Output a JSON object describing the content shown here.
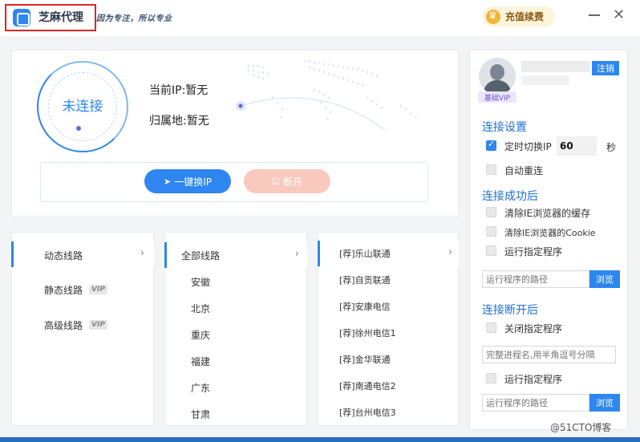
{
  "app": {
    "name": "芝麻代理",
    "slogan": "因为专注，所以专业",
    "recharge_label": "充值续费",
    "close_glyph": "✕"
  },
  "connection": {
    "status": "未连接",
    "ip_label": "当前IP:暂无",
    "location_label": "归属地:暂无",
    "switch_button": "一键换IP",
    "disconnect_button": "断开"
  },
  "line_types": {
    "items": [
      {
        "label": "动态线路",
        "vip": ""
      },
      {
        "label": "静态线路",
        "vip": "VIP"
      },
      {
        "label": "高级线路",
        "vip": "VIP"
      }
    ]
  },
  "regions": {
    "items": [
      "全部线路",
      "安徽",
      "北京",
      "重庆",
      "福建",
      "广东",
      "甘肃"
    ]
  },
  "nodes": {
    "items": [
      "[荐]乐山联通",
      "[荐]自贡联通",
      "[荐]安康电信",
      "[荐]徐州电信1",
      "[荐]金华联通",
      "[荐]南通电信2",
      "[荐]台州电信3"
    ]
  },
  "user": {
    "vip_level": "基础VIP",
    "logout_label": "注销"
  },
  "settings": {
    "connect_title": "连接设置",
    "timer_switch_label": "定时切换IP",
    "timer_value": "60",
    "timer_unit": "秒",
    "auto_reconnect_label": "自动重连",
    "success_title": "连接成功后",
    "clear_cache_label": "清除IE浏览器的缓存",
    "clear_cookie_label": "清除IE浏览器的Cookie",
    "run_program_label": "运行指定程序",
    "program_path_placeholder": "运行程序的路径",
    "browse_label": "浏览",
    "disconnect_title": "连接断开后",
    "close_program_label": "关闭指定程序",
    "process_name_placeholder": "完整进程名,用半角逗号分隔",
    "run_program_label_2": "运行指定程序",
    "program_path_placeholder_2": "运行程序的路径",
    "browse_label_2": "浏览"
  },
  "watermark": "@51CTO博客",
  "colors": {
    "accent": "#2e86ef",
    "highlight_border": "#e02424",
    "disconnect_bg": "#f9c9bd"
  }
}
